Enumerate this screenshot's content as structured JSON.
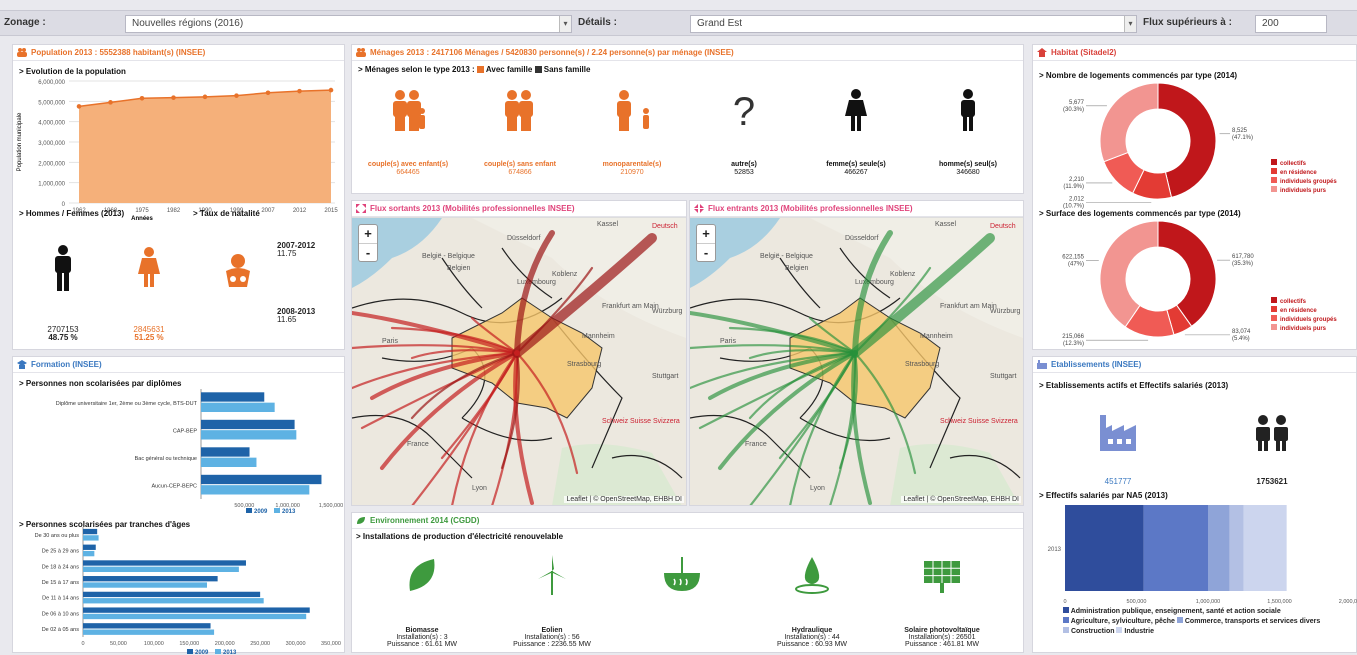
{
  "topbar": {
    "zonage_label": "Zonage :",
    "zonage_value": "Nouvelles régions (2016)",
    "details_label": "Détails :",
    "details_value": "Grand Est",
    "flux_label": "Flux supérieurs à :",
    "flux_value": "200"
  },
  "population": {
    "title": "Population 2013 : 5552388 habitant(s) (INSEE)",
    "evolution_title": "> Evolution de la population",
    "ylabel": "Population municipale",
    "xlabel": "Années",
    "yticks": [
      "6,000,000",
      "5,000,000",
      "4,000,000",
      "3,000,000",
      "2,000,000",
      "1,000,000",
      "0"
    ],
    "hf_title": "> Hommes / Femmes (2013)",
    "natalite_title": "> Taux de natalité",
    "hommes_value": "2707153",
    "hommes_pct": "48.75 %",
    "femmes_value": "2845631",
    "femmes_pct": "51.25 %",
    "nat1_period": "2007-2012",
    "nat1_value": "11.75",
    "nat2_period": "2008-2013",
    "nat2_value": "11.65"
  },
  "chart_data": [
    {
      "type": "area",
      "title": "> Evolution de la population",
      "xlabel": "Années",
      "ylabel": "Population municipale",
      "x": [
        "1962",
        "1968",
        "1975",
        "1982",
        "1990",
        "1999",
        "2007",
        "2012",
        "2015"
      ],
      "values": [
        4750000,
        4950000,
        5150000,
        5180000,
        5220000,
        5280000,
        5420000,
        5500000,
        5552000
      ],
      "ylim": [
        0,
        6000000
      ],
      "color": "#f5b07a",
      "grid": true
    },
    {
      "type": "bar",
      "orientation": "horizontal",
      "title": "> Personnes non scolarisées par diplômes",
      "categories": [
        "Diplôme universitaire 1er, 2ème ou 3ème cycle, BTS-DUT",
        "CAP-BEP",
        "Bac général ou technique",
        "Aucun-CEP-BEPC"
      ],
      "xticks": [
        "500,000",
        "1,000,000",
        "1,500,000"
      ],
      "xlim": [
        0,
        1500000
      ],
      "series": [
        {
          "name": "2009",
          "values": [
            730000,
            1080000,
            560000,
            1390000
          ]
        },
        {
          "name": "2013",
          "values": [
            850000,
            1100000,
            640000,
            1250000
          ]
        }
      ]
    },
    {
      "type": "bar",
      "orientation": "horizontal",
      "title": "> Personnes scolarisées par tranches d'âges",
      "categories": [
        "De 30 ans ou plus",
        "De 25 à 29 ans",
        "De 18 à 24 ans",
        "De 15 à 17 ans",
        "De 11 à 14 ans",
        "De 06 à 10 ans",
        "De 02 à 05 ans"
      ],
      "xticks": [
        "0",
        "50,000",
        "100,000",
        "150,000",
        "200,000",
        "250,000",
        "300,000",
        "350,000"
      ],
      "xlim": [
        0,
        350000
      ],
      "series": [
        {
          "name": "2009",
          "values": [
            20000,
            18000,
            230000,
            190000,
            250000,
            320000,
            180000
          ]
        },
        {
          "name": "2013",
          "values": [
            22000,
            16000,
            220000,
            175000,
            255000,
            315000,
            185000
          ]
        }
      ]
    },
    {
      "type": "pie",
      "title": "> Nombre de logements commencés par type (2014)",
      "labels": [
        "collectifs",
        "en résidence",
        "individuels groupés",
        "individuels purs"
      ],
      "values": [
        8525,
        2012,
        2210,
        5677
      ],
      "display": [
        "8,525\n(47.1%)",
        "2,012\n(10.7%)",
        "2,210\n(11.9%)",
        "5,677\n(30.3%)"
      ]
    },
    {
      "type": "pie",
      "title": "> Surface des logements commencés par type (2014)",
      "labels": [
        "collectifs",
        "en résidence",
        "individuels groupés",
        "individuels purs"
      ],
      "values": [
        617780,
        83074,
        215066,
        622155
      ],
      "display": [
        "617,780\n(35.3%)",
        "83,074\n(5.4%)",
        "215,066\n(12.3%)",
        "622,155\n(47%)"
      ]
    },
    {
      "type": "bar",
      "orientation": "horizontal",
      "stacked": true,
      "title": "> Effectifs salariés par NA5 (2013)",
      "categories": [
        "2013"
      ],
      "xticks": [
        "0",
        "500,000",
        "1,000,000",
        "1,500,000",
        "2,000,000"
      ],
      "xlim": [
        0,
        2000000
      ],
      "series": [
        {
          "name": "Administration publique, enseignement, santé et action sociale",
          "values": [
            550000
          ]
        },
        {
          "name": "Agriculture, sylviculture, pêche",
          "values": [
            450000
          ]
        },
        {
          "name": "Commerce, transports et services divers",
          "values": [
            150000
          ]
        },
        {
          "name": "Construction",
          "values": [
            100000
          ]
        },
        {
          "name": "Industrie",
          "values": [
            300000
          ]
        }
      ]
    }
  ],
  "menages": {
    "title": "Ménages 2013 : 2417106 Ménages / 5420830 personne(s) / 2.24 personne(s) par ménage (INSEE)",
    "subtitle": "> Ménages selon le type 2013 :",
    "legend_avec": "Avec famille",
    "legend_sans": "Sans famille",
    "types": [
      {
        "label": "couple(s) avec enfant(s)",
        "value": "664465",
        "color": "#e8722a"
      },
      {
        "label": "couple(s) sans enfant",
        "value": "674866",
        "color": "#e8722a"
      },
      {
        "label": "monoparentale(s)",
        "value": "210970",
        "color": "#e8722a"
      },
      {
        "label": "autre(s)",
        "value": "52853",
        "color": "#111"
      },
      {
        "label": "femme(s) seule(s)",
        "value": "466267",
        "color": "#111"
      },
      {
        "label": "homme(s) seul(s)",
        "value": "346680",
        "color": "#111"
      }
    ]
  },
  "flux_sortants": {
    "title": "Flux sortants 2013 (Mobilités professionnelles INSEE)"
  },
  "flux_entrants": {
    "title": "Flux entrants 2013 (Mobilités professionnelles INSEE)"
  },
  "map": {
    "zoom_in": "+",
    "zoom_out": "-",
    "attribution": "Leaflet | © OpenStreetMap, EHBH DI",
    "places": [
      "Deutsch",
      "Kassel",
      "Düsseldorf",
      "België - Belgique",
      "Belgien",
      "Koblenz",
      "Frankfurt am Main",
      "Mannheim",
      "Luxembourg",
      "Paris",
      "Strasbourg",
      "Schweiz Suisse Svizzera",
      "France",
      "Lyon",
      "Würzburg",
      "Stuttgart"
    ]
  },
  "environnement": {
    "title": "Environnement 2014 (CGDD)",
    "subtitle": "> Installations de production d'électricité renouvelable",
    "items": [
      {
        "name": "Biomasse",
        "installations": "Installation(s) : 3",
        "puissance": "Puissance : 61.61 MW"
      },
      {
        "name": "Eolien",
        "installations": "Installation(s) : 56",
        "puissance": "Puissance : 2236.55 MW"
      },
      {
        "name": "Géothermie",
        "installations": "",
        "puissance": ""
      },
      {
        "name": "Hydraulique",
        "installations": "Installation(s) : 44",
        "puissance": "Puissance : 60.93 MW"
      },
      {
        "name": "Solaire photovoltaïque",
        "installations": "Installation(s) : 26501",
        "puissance": "Puissance : 461.81 MW"
      }
    ]
  },
  "formation": {
    "title": "Formation (INSEE)",
    "legend_2009": "2009",
    "legend_2013": "2013"
  },
  "habitat": {
    "title": "Habitat (Sitadel2)",
    "legend": [
      "collectifs",
      "en résidence",
      "individuels groupés",
      "individuels purs"
    ],
    "colors": [
      "#c0171b",
      "#e33b34",
      "#f05b55",
      "#f29591"
    ]
  },
  "etablissements": {
    "title": "Etablissements (INSEE)",
    "subtitle": "> Etablissements actifs et Effectifs salariés (2013)",
    "etab_value": "451777",
    "effectifs_value": "1753621",
    "na5_colors": [
      "#2f4d9c",
      "#5c78c6",
      "#8fa4d8",
      "#b3c0e4",
      "#ccd5ee"
    ],
    "na5_legend_l1": "Administration publique, enseignement, santé et action sociale",
    "na5_legend_l2a": "Agriculture, sylviculture, pêche",
    "na5_legend_l2b": "Commerce, transports et services divers",
    "na5_legend_l3a": "Construction",
    "na5_legend_l3b": "Industrie"
  }
}
